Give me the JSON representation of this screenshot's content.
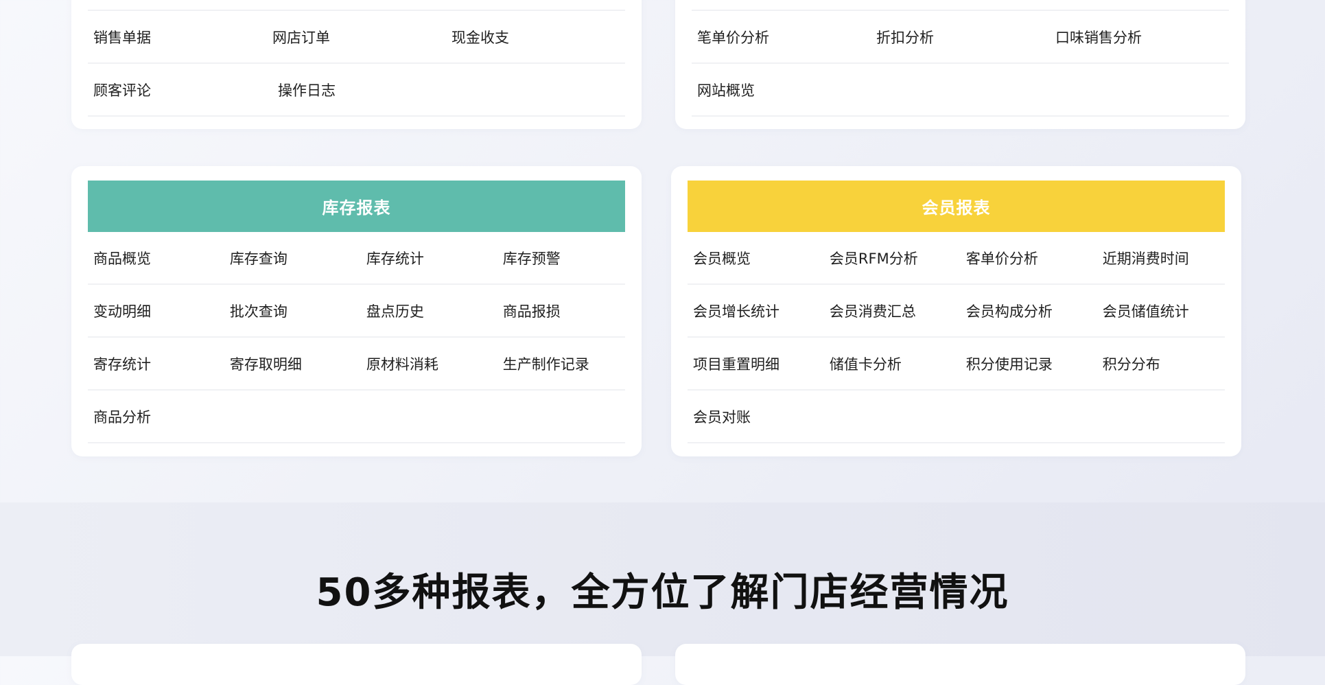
{
  "cards": {
    "sales": {
      "rows": [
        [
          "销售单据",
          "网店订单",
          "现金收支"
        ],
        [
          "顾客评论",
          "操作日志"
        ]
      ]
    },
    "analysis": {
      "rows": [
        [
          "笔单价分析",
          "折扣分析",
          "口味销售分析"
        ],
        [
          "网站概览"
        ]
      ]
    },
    "inventory": {
      "title": "库存报表",
      "color": "#5fbcac",
      "rows": [
        [
          "商品概览",
          "库存查询",
          "库存统计",
          "库存预警"
        ],
        [
          "变动明细",
          "批次查询",
          "盘点历史",
          "商品报损"
        ],
        [
          "寄存统计",
          "寄存取明细",
          "原材料消耗",
          "生产制作记录"
        ],
        [
          "商品分析"
        ]
      ]
    },
    "member": {
      "title": "会员报表",
      "color": "#f8d23b",
      "rows": [
        [
          "会员概览",
          "会员RFM分析",
          "客单价分析",
          "近期消费时间"
        ],
        [
          "会员增长统计",
          "会员消费汇总",
          "会员构成分析",
          "会员储值统计"
        ],
        [
          "项目重置明细",
          "储值卡分析",
          "积分使用记录",
          "积分分布"
        ],
        [
          "会员对账"
        ]
      ]
    }
  },
  "headline": "50多种报表，全方位了解门店经营情况"
}
